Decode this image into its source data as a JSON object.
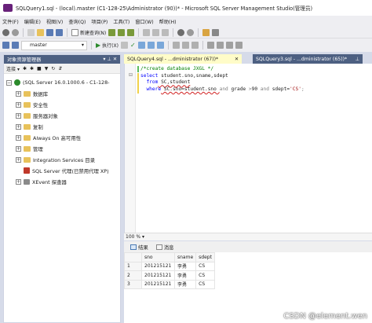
{
  "window": {
    "title": "SQLQuery1.sql - (local).master (C1-128-25\\Administrator (90))* - Microsoft SQL Server Management Studio(管理员)"
  },
  "menu": [
    "文件(F)",
    "编辑(E)",
    "视图(V)",
    "查询(Q)",
    "项目(P)",
    "工具(T)",
    "窗口(W)",
    "帮助(H)"
  ],
  "toolbar": {
    "new_query": "新建查询(N)",
    "database": "master",
    "execute": "执行(X)"
  },
  "object_explorer": {
    "title": "对象资源管理器",
    "connect": "连接",
    "server": "(SQL Server 16.0.1000.6 - C1-128-",
    "nodes": [
      "数据库",
      "安全性",
      "服务器对象",
      "复制",
      "Always On 高可用性",
      "管理",
      "Integration Services 目录",
      "SQL Server 代理(已禁用代理 XP)",
      "XEvent 探查器"
    ]
  },
  "tabs": {
    "active": "SQLQuery4.sql - ...dministrator (67))*",
    "inactive": "SQLQuery3.sql - ...dministrator (65))*"
  },
  "editor": {
    "line1": "/*create database JXGL */",
    "line2_kw": "select",
    "line2_rest": " student.sno,sname,sdept",
    "line3_kw": "from",
    "line3_rest": " SC,student",
    "line4_kw": "where",
    "line4_a": " SC.sno=student.sno ",
    "line4_and1": "and",
    "line4_b": " grade ",
    "line4_gt": ">",
    "line4_num": "90",
    "line4_and2": " and",
    "line4_c": " sdept=",
    "line4_str": "'CS'",
    "line4_end": ";"
  },
  "zoom": "100 %",
  "results": {
    "tab_results": "结果",
    "tab_messages": "消息",
    "columns": [
      "sno",
      "sname",
      "sdept"
    ],
    "rows": [
      {
        "n": "1",
        "sno": "201215121",
        "sname": "李勇",
        "sdept": "CS"
      },
      {
        "n": "2",
        "sno": "201215121",
        "sname": "李勇",
        "sdept": "CS"
      },
      {
        "n": "3",
        "sno": "201215121",
        "sname": "李勇",
        "sdept": "CS"
      }
    ]
  },
  "watermark": "CSDN @element.wen",
  "colors": {
    "accent": "#68217a",
    "header": "#4d6082",
    "active_tab": "#fffcc8"
  }
}
